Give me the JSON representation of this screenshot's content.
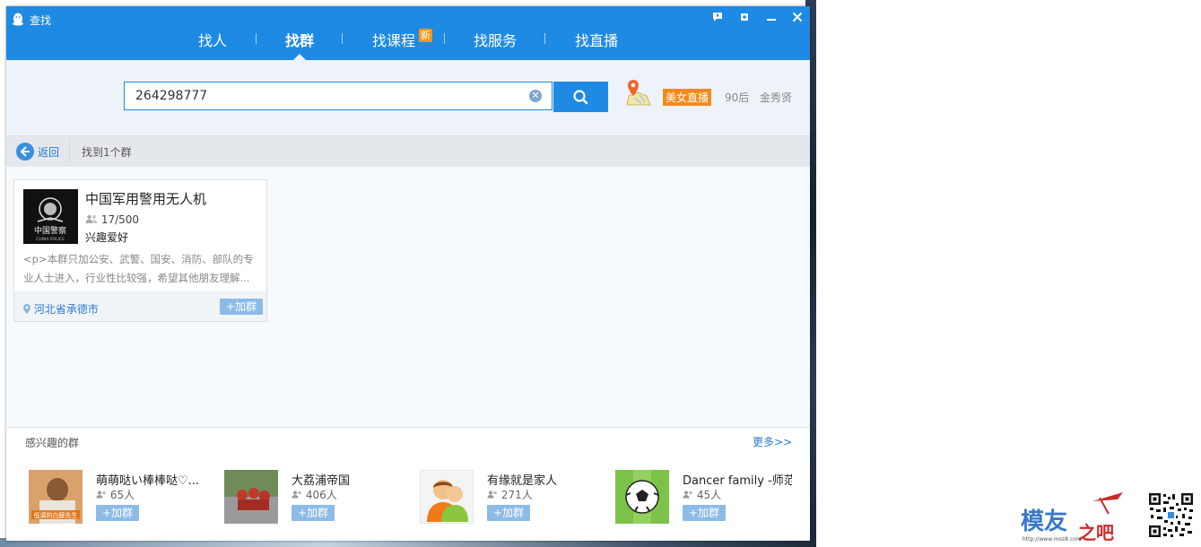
{
  "window": {
    "title": "查找"
  },
  "nav": [
    {
      "label": "找人"
    },
    {
      "label": "找群"
    },
    {
      "label": "找课程"
    },
    {
      "label": "找服务"
    },
    {
      "label": "找直播"
    }
  ],
  "nav_new_badge": "新",
  "active_nav": "找群",
  "search": {
    "value": "264298777"
  },
  "hot_tags": [
    {
      "label": "美女直播"
    },
    {
      "label": "90后"
    },
    {
      "label": "金秀贤"
    }
  ],
  "result_bar": {
    "back_label": "返回",
    "count_text": "找到1个群"
  },
  "result_card": {
    "name": "中国军用警用无人机",
    "members": "17/500",
    "category": "兴趣爱好",
    "description": "<p>本群只加公安、武警、国安、消防、部队的专业人士进入，行业性比较强，希望其他朋友理解...",
    "location": "河北省承德市",
    "join_label": "+加群",
    "avatar_text": "中国警察",
    "avatar_subtext": "CHINA POLICE"
  },
  "recommend": {
    "title": "感兴趣的群",
    "more_label": "更多>>",
    "groups": [
      {
        "name": "萌萌哒い棒棒哒♡...",
        "count": "65人",
        "join_label": "+加群",
        "avatar_caption": "低调的白膜先生"
      },
      {
        "name": "大荔浦帝国",
        "count": "406人",
        "join_label": "+加群"
      },
      {
        "name": "有缘就是家人",
        "count": "271人",
        "join_label": "+加群"
      },
      {
        "name": "Dancer family -师范",
        "count": "45人",
        "join_label": "+加群"
      }
    ]
  },
  "watermark": {
    "brand": "模友",
    "suffix": "之吧",
    "url": "http://www.moz8.com"
  },
  "colors": {
    "primary": "#1f8ae4",
    "link": "#2a7ad0",
    "hot_tag": "#f38b1b",
    "join_button": "#8cbbe8"
  }
}
